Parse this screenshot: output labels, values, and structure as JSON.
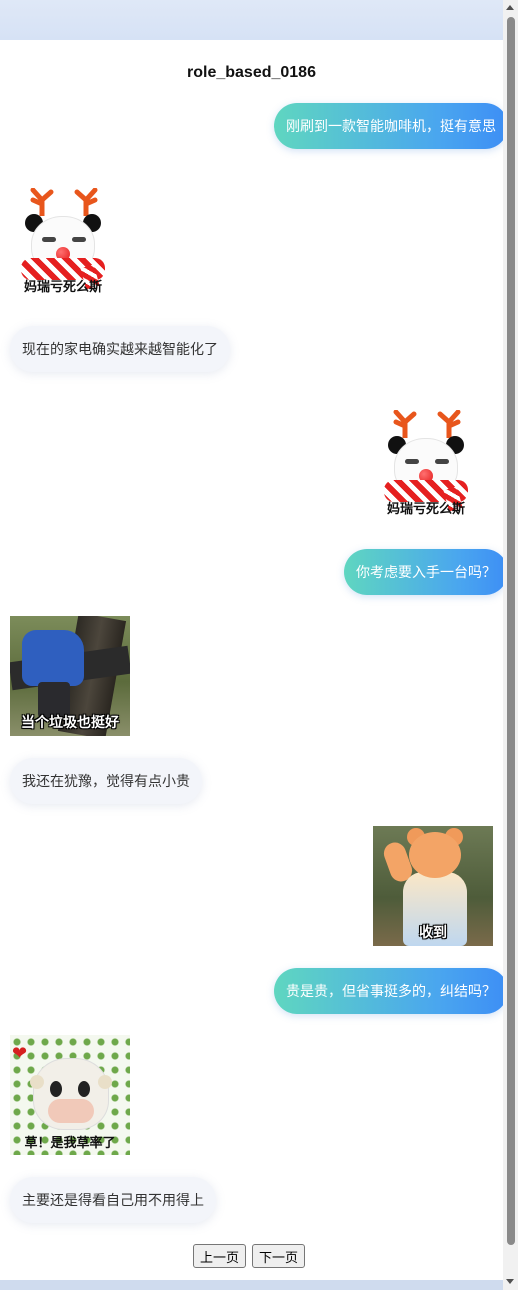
{
  "title": "role_based_0186",
  "messages": [
    {
      "side": "right",
      "type": "text",
      "text": "刚刷到一款智能咖啡机，挺有意思"
    },
    {
      "side": "left",
      "type": "sticker",
      "sticker": "panda-reindeer",
      "caption": "妈瑞亏死么斯"
    },
    {
      "side": "left",
      "type": "text",
      "text": "现在的家电确实越来越智能化了"
    },
    {
      "side": "right",
      "type": "sticker",
      "sticker": "panda-reindeer",
      "caption": "妈瑞亏死么斯"
    },
    {
      "side": "right",
      "type": "text",
      "text": "你考虑要入手一台吗？"
    },
    {
      "side": "left",
      "type": "sticker",
      "sticker": "worker-photo",
      "caption": "当个垃圾也挺好"
    },
    {
      "side": "left",
      "type": "text",
      "text": "我还在犹豫，觉得有点小贵"
    },
    {
      "side": "right",
      "type": "sticker",
      "sticker": "bear-photo",
      "caption": "收到"
    },
    {
      "side": "right",
      "type": "text",
      "text": "贵是贵，但省事挺多的，纠结吗？"
    },
    {
      "side": "left",
      "type": "sticker",
      "sticker": "cow-photo",
      "caption": "草！是我草率了"
    },
    {
      "side": "left",
      "type": "text",
      "text": "主要还是得看自己用不用得上"
    }
  ],
  "pager": {
    "prev_label": "上一页",
    "next_label": "下一页"
  }
}
